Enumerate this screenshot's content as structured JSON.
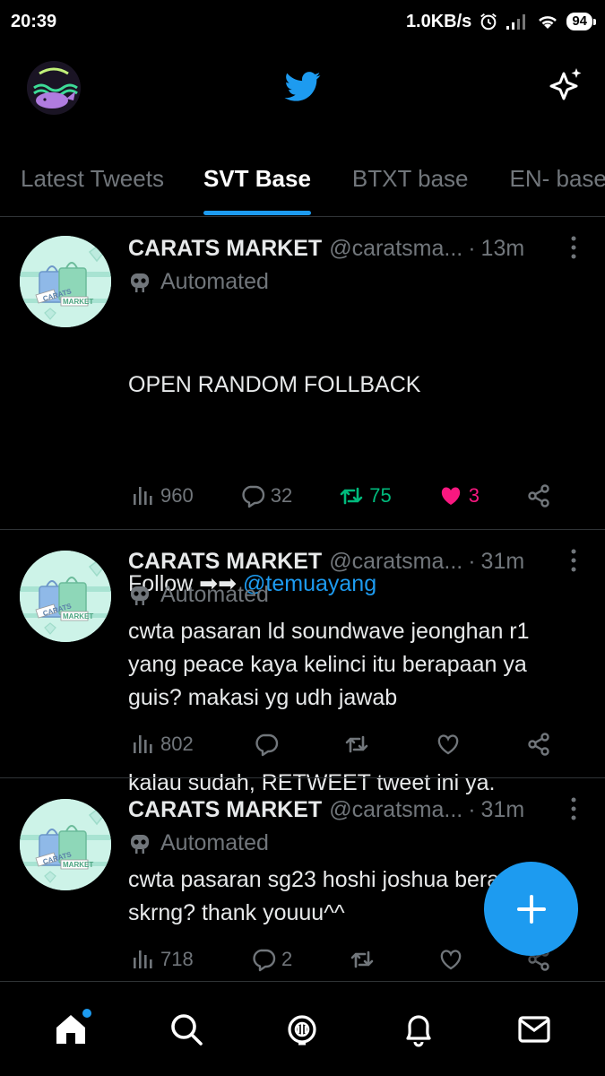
{
  "status_bar": {
    "time": "20:39",
    "speed": "1.0KB/s",
    "battery": "94"
  },
  "tabs": [
    {
      "label": "Latest Tweets"
    },
    {
      "label": "SVT Base"
    },
    {
      "label": "BTXT base"
    },
    {
      "label": "EN- base"
    }
  ],
  "tweets": [
    {
      "name": "CARATS MARKET",
      "handle": "@caratsma...",
      "time": "13m",
      "automated": "Automated",
      "text_line1": "OPEN RANDOM FOLLBACK",
      "text_follow": "Follow ➡➡ ",
      "mention": "@temuayang",
      "text_line3": "kalau sudah, RETWEET tweet ini ya.",
      "views": "960",
      "replies": "32",
      "retweets": "75",
      "likes": "3"
    },
    {
      "name": "CARATS MARKET",
      "handle": "@caratsma...",
      "time": "31m",
      "automated": "Automated",
      "text": "cwta pasaran ld soundwave jeonghan r1 yang peace kaya kelinci itu berapaan ya guis? makasi yg udh jawab",
      "views": "802",
      "replies": "",
      "retweets": "",
      "likes": ""
    },
    {
      "name": "CARATS MARKET",
      "handle": "@caratsma...",
      "time": "31m",
      "automated": "Automated",
      "text": "cwta pasaran sg23 hoshi joshua berapa ya skrng? thank youuu^^",
      "views": "718",
      "replies": "2",
      "retweets": "",
      "likes": ""
    }
  ],
  "avatar_label": {
    "carats": "CARATS",
    "market": "MARKET"
  },
  "colors": {
    "accent": "#1d9bf0",
    "retweet": "#00ba7c",
    "like": "#f91880",
    "muted": "#71767b"
  },
  "icons": {
    "header": [
      "profile-avatar",
      "twitter-bird-icon",
      "sparkle-icon"
    ],
    "nav": [
      "home-icon",
      "search-icon",
      "spaces-icon",
      "notifications-icon",
      "messages-icon"
    ],
    "fab": "plus-icon"
  }
}
